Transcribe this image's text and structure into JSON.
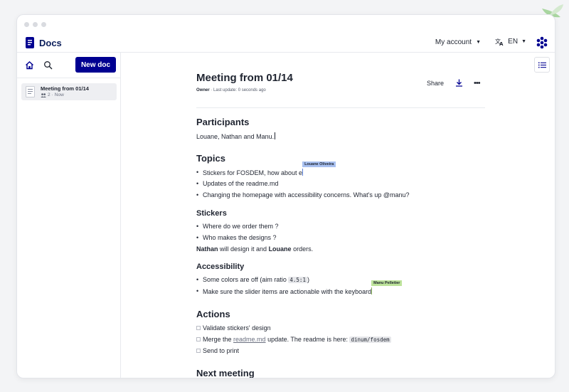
{
  "app": {
    "name": "Docs",
    "account_label": "My account",
    "language": "EN"
  },
  "sidebar": {
    "new_doc_label": "New doc",
    "documents": [
      {
        "title": "Meeting from 01/14",
        "members": "2",
        "updated": "Now"
      }
    ]
  },
  "document": {
    "title": "Meeting from 01/14",
    "role": "Owner",
    "last_update": "Last update: 0 seconds ago",
    "share_label": "Share",
    "blocks": {
      "participants_heading": "Participants",
      "participants_text": "Louane, Nathan and Manu.",
      "topics_heading": "Topics",
      "topics": [
        "Stickers for FOSDEM, how about e",
        "Updates of the readme.md",
        "Changing the homepage with accessibility concerns. What's up @manu?"
      ],
      "stickers_heading": "Stickers",
      "stickers": [
        "Where do we order them ?",
        "Who makes the designs ?"
      ],
      "stickers_note": {
        "name1": "Nathan",
        "mid": " will design it and ",
        "name2": "Louane",
        "end": " orders."
      },
      "accessibility_heading": "Accessibility",
      "accessibility": {
        "item1_prefix": "Some colors are off (aim ratio ",
        "item1_code": "4.5:1",
        "item1_suffix": ")",
        "item2": "Make sure the slider items are actionable with the keyboard"
      },
      "actions_heading": "Actions",
      "actions": {
        "item1": "Validate stickers' design",
        "item2_prefix": "Merge the ",
        "item2_link": "readme.md",
        "item2_mid": " update. The readme is here: ",
        "item2_code": "dinum/fosdem",
        "item3": "Send to print"
      },
      "next_heading": "Next meeting"
    }
  },
  "collaborators": [
    {
      "name": "Louane Oliveira",
      "color": "#a8c0f0"
    },
    {
      "name": "Manu Pelletier",
      "color": "#bde39b"
    }
  ],
  "colors": {
    "primary": "#000091",
    "text": "#1f2430"
  }
}
